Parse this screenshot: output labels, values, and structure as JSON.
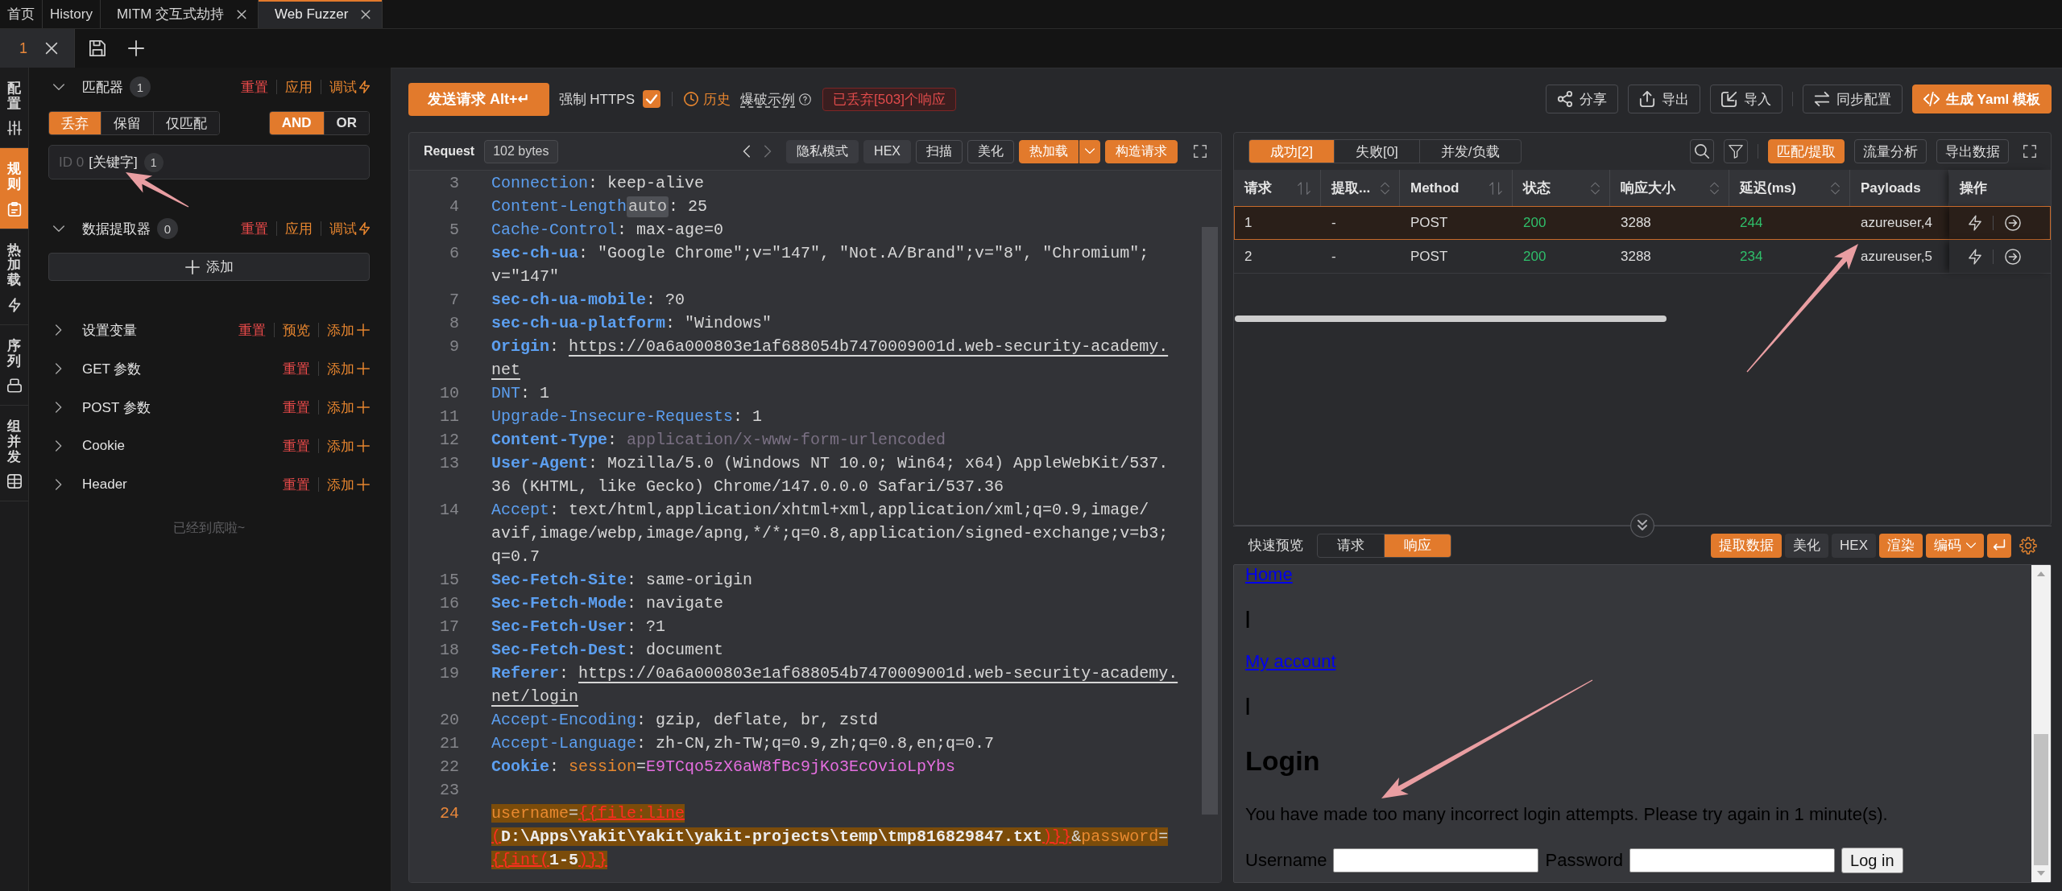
{
  "tabs": [
    {
      "label": "首页",
      "selected": false,
      "closable": false
    },
    {
      "label": "History",
      "selected": false,
      "closable": false
    },
    {
      "label": "MITM 交互式劫持",
      "selected": false,
      "closable": true
    },
    {
      "label": "Web Fuzzer",
      "selected": true,
      "closable": true
    }
  ],
  "subtabs": [
    {
      "label": "1",
      "selected": true
    }
  ],
  "side_nav": [
    {
      "label": "配置",
      "selected": false
    },
    {
      "label": "规则",
      "selected": true
    },
    {
      "label": "热加载",
      "selected": false
    },
    {
      "label": "序列",
      "selected": false
    },
    {
      "label": "组并发",
      "selected": false
    }
  ],
  "rules": {
    "sections": [
      {
        "kind": "matcher",
        "title": "匹配器",
        "count": "1",
        "expanded": true,
        "actions": [
          {
            "label": "重置",
            "kind": "reset"
          },
          {
            "label": "应用",
            "kind": "apply"
          },
          {
            "label": "调试",
            "kind": "debug"
          }
        ],
        "modes": [
          {
            "label": "丢弃",
            "selected": true
          },
          {
            "label": "保留",
            "selected": false
          },
          {
            "label": "仅匹配",
            "selected": false
          }
        ],
        "logic": [
          {
            "label": "AND",
            "selected": true
          },
          {
            "label": "OR",
            "selected": false
          }
        ],
        "items": [
          {
            "id": "ID 0",
            "type": "[关键字]",
            "count": "1"
          }
        ]
      },
      {
        "kind": "extractor",
        "title": "数据提取器",
        "count": "0",
        "expanded": true,
        "actions": [
          {
            "label": "重置",
            "kind": "reset"
          },
          {
            "label": "应用",
            "kind": "apply"
          },
          {
            "label": "调试",
            "kind": "debug"
          }
        ],
        "add_label": "添加"
      },
      {
        "kind": "plain",
        "title": "设置变量",
        "expanded": false,
        "actions": [
          {
            "label": "重置",
            "kind": "reset"
          },
          {
            "label": "预览",
            "kind": "preview"
          },
          {
            "label": "添加",
            "kind": "add"
          }
        ]
      },
      {
        "kind": "plain",
        "title": "GET 参数",
        "expanded": false,
        "actions": [
          {
            "label": "重置",
            "kind": "reset"
          },
          {
            "label": "添加",
            "kind": "add"
          }
        ]
      },
      {
        "kind": "plain",
        "title": "POST 参数",
        "expanded": false,
        "actions": [
          {
            "label": "重置",
            "kind": "reset"
          },
          {
            "label": "添加",
            "kind": "add"
          }
        ]
      },
      {
        "kind": "plain",
        "title": "Cookie",
        "expanded": false,
        "actions": [
          {
            "label": "重置",
            "kind": "reset"
          },
          {
            "label": "添加",
            "kind": "add"
          }
        ]
      },
      {
        "kind": "plain",
        "title": "Header",
        "expanded": false,
        "actions": [
          {
            "label": "重置",
            "kind": "reset"
          },
          {
            "label": "添加",
            "kind": "add"
          }
        ]
      }
    ],
    "end_note": "已经到底啦~"
  },
  "toolbar": {
    "send_label": "发送请求 Alt+↵",
    "force_https": {
      "label": "强制 HTTPS",
      "checked": true
    },
    "history_label": "历史",
    "example_label": "爆破示例",
    "discarded": "已丢弃[503]个响应",
    "button_groups": [
      [
        {
          "label": "分享",
          "kind": "default"
        },
        {
          "label": "导出",
          "kind": "default"
        },
        {
          "label": "导入",
          "kind": "default"
        }
      ],
      [
        {
          "label": "同步配置",
          "kind": "default"
        },
        {
          "label": "生成 Yaml 模板",
          "kind": "primary"
        }
      ]
    ]
  },
  "request": {
    "title": "Request",
    "size": "102 bytes",
    "tools": [
      {
        "label": "隐私模式",
        "kind": "toggle"
      },
      {
        "label": "HEX",
        "kind": "toggle"
      },
      {
        "label": "扫描",
        "kind": "outline"
      },
      {
        "label": "美化",
        "kind": "outline"
      },
      {
        "label": "热加载",
        "kind": "split"
      },
      {
        "label": "构造请求",
        "kind": "primary"
      }
    ],
    "lines": [
      {
        "number": "3",
        "current": false,
        "highlighted": false,
        "segments": [
          {
            "kind": "key",
            "text": "Connection"
          },
          {
            "kind": "plain",
            "text": ": keep-alive"
          }
        ]
      },
      {
        "number": "4",
        "current": false,
        "highlighted": false,
        "segments": [
          {
            "kind": "key",
            "text": "Content-Length"
          },
          {
            "kind": "hint",
            "text": "auto"
          },
          {
            "kind": "plain",
            "text": ": 25"
          }
        ]
      },
      {
        "number": "5",
        "current": false,
        "highlighted": false,
        "segments": [
          {
            "kind": "key",
            "text": "Cache-Control"
          },
          {
            "kind": "plain",
            "text": ": max-age=0"
          }
        ]
      },
      {
        "number": "6",
        "current": false,
        "highlighted": false,
        "segments": [
          {
            "kind": "key_strong",
            "text": "sec-ch-ua"
          },
          {
            "kind": "plain",
            "text": ": \"Google Chrome\";v=\"147\", \"Not.A/Brand\";v=\"8\", \"Chromium\";v=\"147\""
          }
        ]
      },
      {
        "number": "7",
        "current": false,
        "highlighted": false,
        "segments": [
          {
            "kind": "key_strong",
            "text": "sec-ch-ua-mobile"
          },
          {
            "kind": "plain",
            "text": ": ?0"
          }
        ]
      },
      {
        "number": "8",
        "current": false,
        "highlighted": false,
        "segments": [
          {
            "kind": "key_strong",
            "text": "sec-ch-ua-platform"
          },
          {
            "kind": "plain",
            "text": ": \"Windows\""
          }
        ]
      },
      {
        "number": "9",
        "current": false,
        "highlighted": false,
        "segments": [
          {
            "kind": "key_strong",
            "text": "Origin"
          },
          {
            "kind": "plain",
            "text": ": "
          },
          {
            "kind": "link",
            "text": "https://0a6a000803e1af688054b7470009001d.web-security-academy.net"
          }
        ]
      },
      {
        "number": "10",
        "current": false,
        "highlighted": false,
        "segments": [
          {
            "kind": "key",
            "text": "DNT"
          },
          {
            "kind": "plain",
            "text": ": 1"
          }
        ]
      },
      {
        "number": "11",
        "current": false,
        "highlighted": false,
        "segments": [
          {
            "kind": "key",
            "text": "Upgrade-Insecure-Requests"
          },
          {
            "kind": "plain",
            "text": ": 1"
          }
        ]
      },
      {
        "number": "12",
        "current": false,
        "highlighted": false,
        "segments": [
          {
            "kind": "key_strong",
            "text": "Content-Type"
          },
          {
            "kind": "plain",
            "text": ": "
          },
          {
            "kind": "muted",
            "text": "application/x-www-form-urlencoded"
          }
        ]
      },
      {
        "number": "13",
        "current": false,
        "highlighted": false,
        "segments": [
          {
            "kind": "key_strong",
            "text": "User-Agent"
          },
          {
            "kind": "plain",
            "text": ": Mozilla/5.0 (Windows NT 10.0; Win64; x64) AppleWebKit/537.36 (KHTML, like Gecko) Chrome/147.0.0.0 Safari/537.36"
          }
        ]
      },
      {
        "number": "14",
        "current": false,
        "highlighted": false,
        "segments": [
          {
            "kind": "key",
            "text": "Accept"
          },
          {
            "kind": "plain",
            "text": ": text/html,application/xhtml+xml,application/xml;q=0.9,image/avif,image/webp,image/apng,*/*;q=0.8,application/signed-exchange;v=b3;q=0.7"
          }
        ]
      },
      {
        "number": "15",
        "current": false,
        "highlighted": false,
        "segments": [
          {
            "kind": "key_strong",
            "text": "Sec-Fetch-Site"
          },
          {
            "kind": "plain",
            "text": ": same-origin"
          }
        ]
      },
      {
        "number": "16",
        "current": false,
        "highlighted": false,
        "segments": [
          {
            "kind": "key_strong",
            "text": "Sec-Fetch-Mode"
          },
          {
            "kind": "plain",
            "text": ": navigate"
          }
        ]
      },
      {
        "number": "17",
        "current": false,
        "highlighted": false,
        "segments": [
          {
            "kind": "key_strong",
            "text": "Sec-Fetch-User"
          },
          {
            "kind": "plain",
            "text": ": ?1"
          }
        ]
      },
      {
        "number": "18",
        "current": false,
        "highlighted": false,
        "segments": [
          {
            "kind": "key_strong",
            "text": "Sec-Fetch-Dest"
          },
          {
            "kind": "plain",
            "text": ": document"
          }
        ]
      },
      {
        "number": "19",
        "current": false,
        "highlighted": false,
        "segments": [
          {
            "kind": "key_strong",
            "text": "Referer"
          },
          {
            "kind": "plain",
            "text": ": "
          },
          {
            "kind": "link",
            "text": "https://0a6a000803e1af688054b7470009001d.web-security-academy.net/login"
          }
        ]
      },
      {
        "number": "20",
        "current": false,
        "highlighted": false,
        "segments": [
          {
            "kind": "key",
            "text": "Accept-Encoding"
          },
          {
            "kind": "plain",
            "text": ": gzip, deflate, br, zstd"
          }
        ]
      },
      {
        "number": "21",
        "current": false,
        "highlighted": false,
        "segments": [
          {
            "kind": "key",
            "text": "Accept-Language"
          },
          {
            "kind": "plain",
            "text": ": zh-CN,zh-TW;q=0.9,zh;q=0.8,en;q=0.7"
          }
        ]
      },
      {
        "number": "22",
        "current": false,
        "highlighted": false,
        "segments": [
          {
            "kind": "key_strong",
            "text": "Cookie"
          },
          {
            "kind": "plain",
            "text": ": "
          },
          {
            "kind": "param",
            "text": "session"
          },
          {
            "kind": "plain",
            "text": "="
          },
          {
            "kind": "secret",
            "text": "E9TCqo5zX6aW8fBc9jKo3EcOvioLpYbs"
          }
        ]
      },
      {
        "number": "23",
        "current": false,
        "highlighted": false
      },
      {
        "number": "24",
        "current": true,
        "highlighted": true,
        "segments": [
          {
            "kind": "param",
            "text": "username"
          },
          {
            "kind": "plain",
            "text": "="
          },
          {
            "kind": "tag",
            "text": "{{file:line("
          },
          {
            "kind": "value",
            "text": "D:\\Apps\\Yakit\\Yakit\\yakit-projects\\temp\\tmp816829847.txt"
          },
          {
            "kind": "tag",
            "text": ")}}"
          },
          {
            "kind": "plain",
            "text": "&"
          },
          {
            "kind": "param",
            "text": "password"
          },
          {
            "kind": "plain",
            "text": "="
          },
          {
            "kind": "tag",
            "text": "{{int("
          },
          {
            "kind": "value",
            "text": "1-5"
          },
          {
            "kind": "tag",
            "text": ")}}"
          }
        ]
      }
    ]
  },
  "results": {
    "tabs": [
      {
        "label": "成功[2]",
        "selected": true
      },
      {
        "label": "失败[0]",
        "selected": false
      },
      {
        "label": "并发/负载",
        "selected": false
      }
    ],
    "tools": [
      {
        "label": "匹配/提取",
        "kind": "primary"
      },
      {
        "label": "流量分析",
        "kind": "outline"
      },
      {
        "label": "导出数据",
        "kind": "outline"
      }
    ],
    "columns": [
      {
        "label": "请求",
        "kind": "text",
        "sort": {
          "kind": "arrows"
        }
      },
      {
        "label": "提取...",
        "kind": "text",
        "sort": {
          "kind": "chevrons"
        }
      },
      {
        "label": "Method",
        "kind": "text",
        "sort": {
          "kind": "arrows"
        }
      },
      {
        "label": "状态",
        "kind": "metric",
        "sort": {
          "kind": "chevrons"
        }
      },
      {
        "label": "响应大小",
        "kind": "text",
        "sort": {
          "kind": "chevrons"
        }
      },
      {
        "label": "延迟(ms)",
        "kind": "metric",
        "sort": {
          "kind": "chevrons"
        }
      },
      {
        "label": "Payloads",
        "kind": "text"
      },
      {
        "label": "操作",
        "kind": "actions"
      }
    ],
    "rows": [
      {
        "selected": true,
        "cells": [
          "1",
          "-",
          "POST",
          "200",
          "3288",
          "244",
          "azureuser,4"
        ]
      },
      {
        "selected": false,
        "cells": [
          "2",
          "-",
          "POST",
          "200",
          "3288",
          "234",
          "azureuser,5"
        ]
      }
    ]
  },
  "preview": {
    "label": "快速预览",
    "tabs": [
      {
        "label": "请求",
        "selected": false
      },
      {
        "label": "响应",
        "selected": true
      }
    ],
    "tools": [
      {
        "label": "提取数据",
        "on": true,
        "kind": "button"
      },
      {
        "label": "美化",
        "on": false,
        "kind": "button"
      },
      {
        "label": "HEX",
        "on": false,
        "kind": "button"
      },
      {
        "label": "渲染",
        "on": true,
        "kind": "button"
      },
      {
        "label": "编码",
        "on": true,
        "kind": "dropdown"
      }
    ],
    "wrap": {
      "on": true
    },
    "page": [
      {
        "kind": "link",
        "text": "Home"
      },
      {
        "kind": "text",
        "text": "|"
      },
      {
        "kind": "link",
        "text": "My account"
      },
      {
        "kind": "text",
        "text": "|"
      },
      {
        "kind": "heading",
        "text": "Login"
      },
      {
        "kind": "paragraph",
        "text": "You have made too many incorrect login attempts. Please try again in 1 minute(s)."
      },
      {
        "kind": "form",
        "fields": [
          {
            "label": "Username"
          },
          {
            "label": "Password"
          }
        ],
        "button": "Log in"
      }
    ]
  }
}
